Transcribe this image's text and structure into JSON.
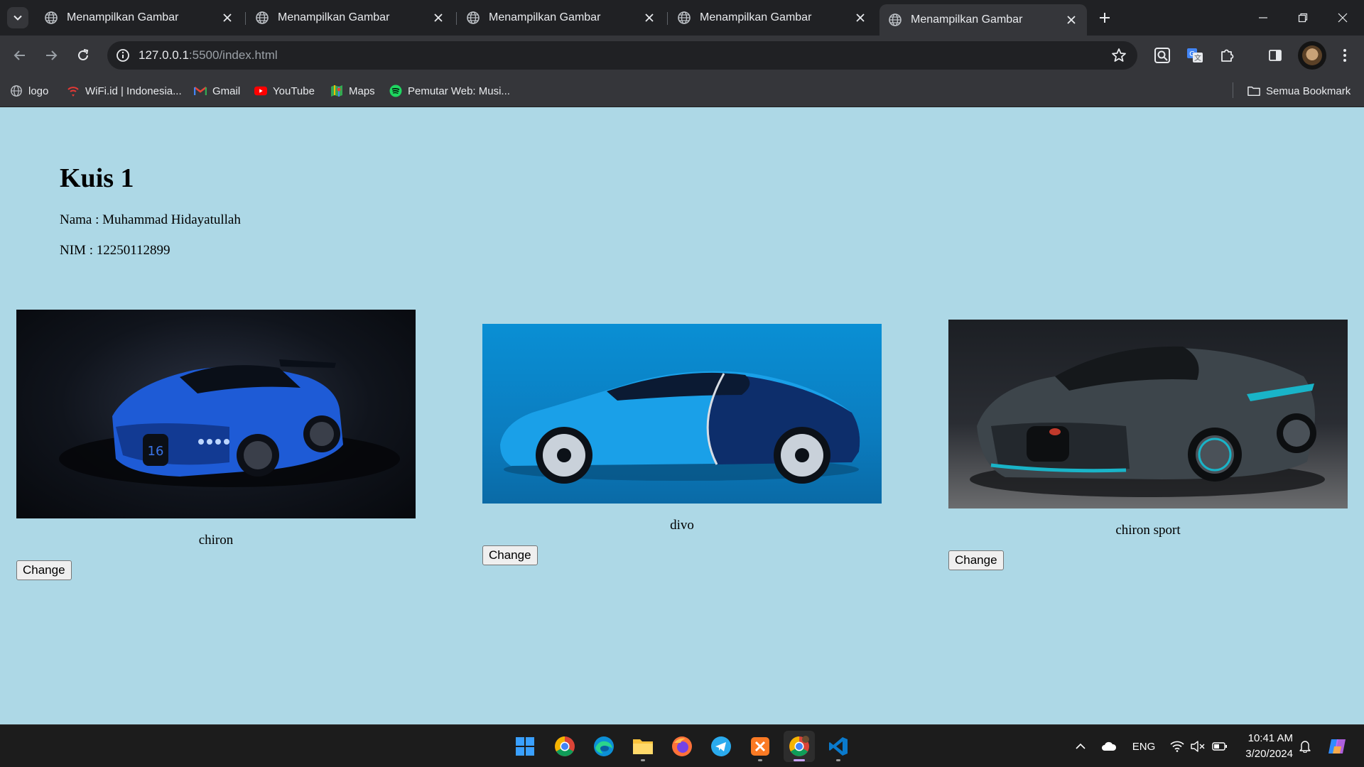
{
  "browser": {
    "tabs": [
      {
        "title": "Menampilkan Gambar",
        "active": false
      },
      {
        "title": "Menampilkan Gambar",
        "active": false
      },
      {
        "title": "Menampilkan Gambar",
        "active": false
      },
      {
        "title": "Menampilkan Gambar",
        "active": false
      },
      {
        "title": "Menampilkan Gambar",
        "active": true
      }
    ],
    "url_host": "127.0.0.1",
    "url_path": ":5500/index.html",
    "bookmarks": [
      {
        "label": "logo",
        "icon": "globe-icon"
      },
      {
        "label": "WiFi.id | Indonesia...",
        "icon": "wifi-id-icon"
      },
      {
        "label": "Gmail",
        "icon": "gmail-icon"
      },
      {
        "label": "YouTube",
        "icon": "youtube-icon"
      },
      {
        "label": "Maps",
        "icon": "maps-icon"
      },
      {
        "label": "Pemutar Web: Musi...",
        "icon": "spotify-icon"
      }
    ],
    "all_bookmarks_label": "Semua Bookmark"
  },
  "page": {
    "title": "Kuis 1",
    "nama": "Nama : Muhammad Hidayatullah",
    "nim": "NIM : 12250112899",
    "cards": [
      {
        "caption": "chiron",
        "button": "Change"
      },
      {
        "caption": "divo",
        "button": "Change"
      },
      {
        "caption": "chiron sport",
        "button": "Change"
      }
    ]
  },
  "taskbar": {
    "language": "ENG",
    "time": "10:41 AM",
    "date": "3/20/2024"
  },
  "colors": {
    "page_background": "#add8e6",
    "chrome_dark": "#202124",
    "chrome_toolbar": "#35363a",
    "taskbar": "#1c1c1c"
  }
}
